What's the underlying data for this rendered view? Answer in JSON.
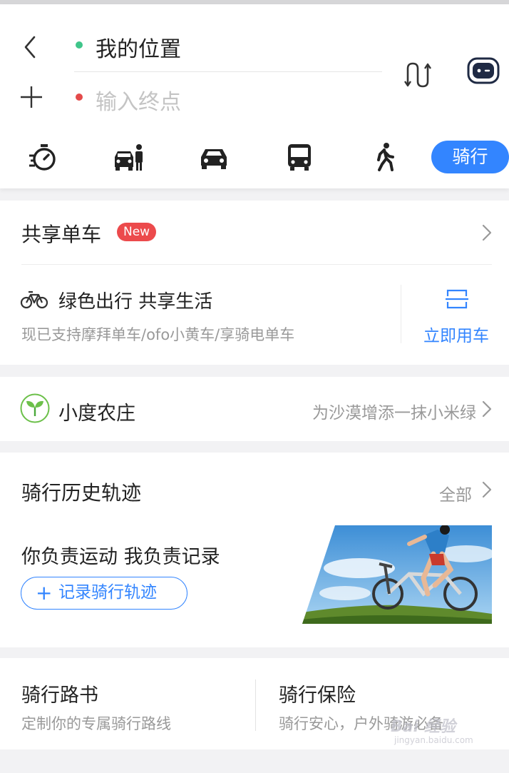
{
  "route": {
    "start_label": "我的位置",
    "destination_placeholder": "输入终点"
  },
  "modes": [
    {
      "name": "timer-icon"
    },
    {
      "name": "taxi-icon"
    },
    {
      "name": "car-icon"
    },
    {
      "name": "bus-icon"
    },
    {
      "name": "walk-icon"
    },
    {
      "name": "cycling",
      "label": "骑行",
      "active": true
    }
  ],
  "shared_bike": {
    "title": "共享单车",
    "badge": "New",
    "slogan": "绿色出行 共享生活",
    "support_text": "现已支持摩拜单车/ofo小黄车/享骑电单车",
    "action_label": "立即用车"
  },
  "farm": {
    "title": "小度农庄",
    "description": "为沙漠增添一抹小米绿"
  },
  "history": {
    "title": "骑行历史轨迹",
    "all_label": "全部",
    "slogan": "你负责运动 我负责记录",
    "record_button": "记录骑行轨迹",
    "record_plus": "+"
  },
  "route_book": {
    "title": "骑行路书",
    "subtitle": "定制你的专属骑行路线"
  },
  "insurance": {
    "title": "骑行保险",
    "subtitle": "骑行安心，户外骑游必备"
  },
  "watermark": {
    "brand": "Bai 经验",
    "url": "jingyan.baidu.com"
  },
  "colors": {
    "accent": "#3385ff",
    "badge": "#ec4a4c",
    "start_dot": "#3fc58a",
    "end_dot": "#e44a4a"
  }
}
